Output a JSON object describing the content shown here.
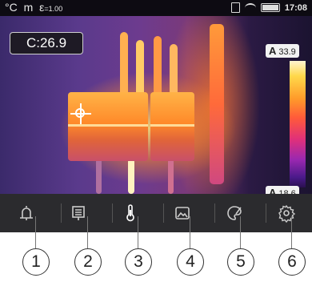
{
  "status_bar": {
    "unit": "°C",
    "mode_glyph": "m",
    "emissivity_symbol": "ε",
    "emissivity_value": "=1.00",
    "time": "17:08"
  },
  "measurement": {
    "center_label": "C:26.9"
  },
  "scale": {
    "max_marker": "A",
    "max_value": "33.9",
    "min_marker": "A",
    "min_value": "18.6"
  },
  "toolbar": {
    "items": [
      {
        "name": "alarm",
        "icon": "bell-icon"
      },
      {
        "name": "menu",
        "icon": "menu-list-icon"
      },
      {
        "name": "measure",
        "icon": "thermometer-icon"
      },
      {
        "name": "gallery",
        "icon": "image-icon"
      },
      {
        "name": "palette",
        "icon": "palette-icon"
      },
      {
        "name": "settings",
        "icon": "gear-icon"
      }
    ]
  },
  "callouts": [
    "1",
    "2",
    "3",
    "4",
    "5",
    "6"
  ],
  "colors": {
    "toolbar_bg": "#2b2b2e",
    "status_bg": "#0d0b12",
    "hot": "#ffb347",
    "cold": "#3b2a6b"
  }
}
